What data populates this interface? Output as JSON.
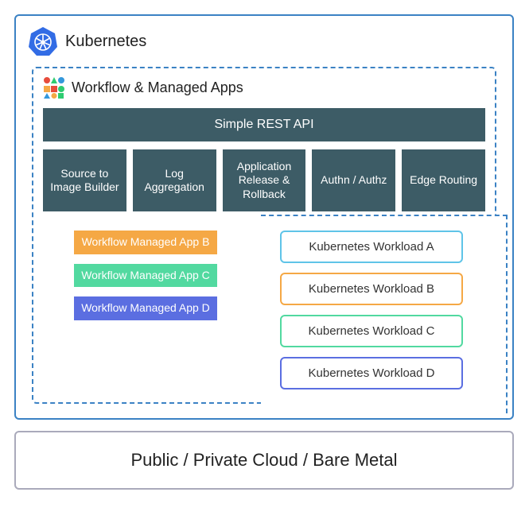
{
  "kubernetes": {
    "title": "Kubernetes"
  },
  "workflow": {
    "title": "Workflow & Managed Apps",
    "rest_api": "Simple REST API",
    "components": [
      "Source to Image Builder",
      "Log Aggregation",
      "Application Release & Rollback",
      "Authn / Authz",
      "Edge Routing"
    ],
    "managed_apps": {
      "b": "Workflow Managed App B",
      "c": "Workflow Managed App C",
      "d": "Workflow Managed App D"
    }
  },
  "workloads": {
    "a": "Kubernetes Workload A",
    "b": "Kubernetes Workload B",
    "c": "Kubernetes Workload C",
    "d": "Kubernetes Workload D"
  },
  "footer": "Public / Private Cloud / Bare Metal",
  "colors": {
    "k8s_blue": "#326ce5",
    "box_teal": "#3d5c66",
    "orange": "#f5a845",
    "green": "#52d9a0",
    "purple": "#5b6ee1",
    "lightblue": "#5fc4e8"
  }
}
